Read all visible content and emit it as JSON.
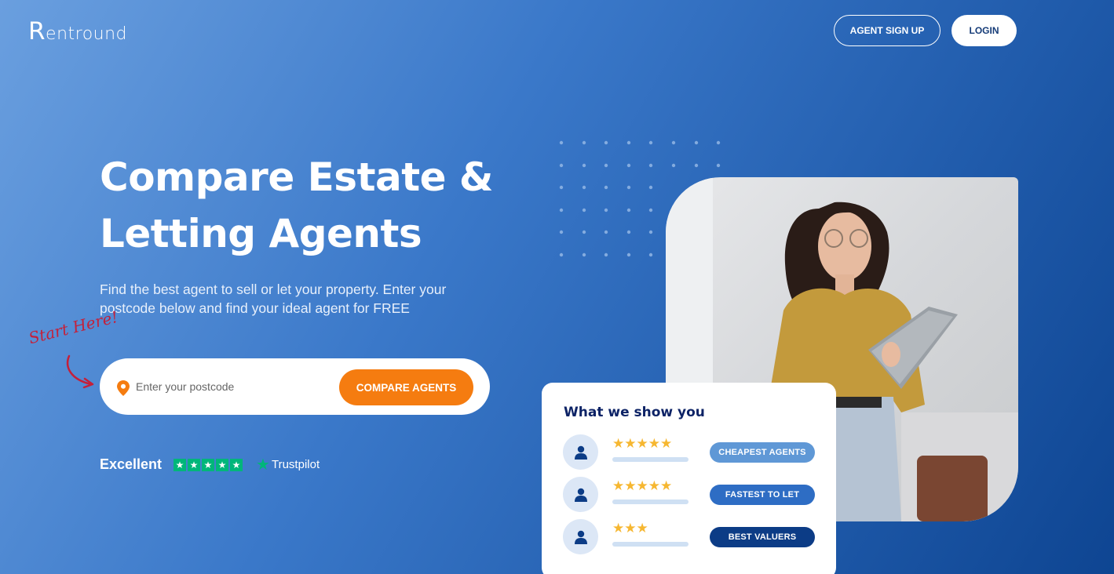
{
  "header": {
    "logo_first_letter": "R",
    "logo_rest": "entround",
    "agent_signup_label": "AGENT SIGN UP",
    "login_label": "LOGIN"
  },
  "hero": {
    "title_line1": "Compare Estate &",
    "title_line2": "Letting Agents",
    "subtitle": "Find the best agent to sell or let your property. Enter your postcode below and find your ideal agent for FREE",
    "start_here": "Start Here!"
  },
  "search": {
    "placeholder": "Enter your postcode",
    "value": "",
    "button_label": "COMPARE AGENTS"
  },
  "trust": {
    "rating_text": "Excellent",
    "stars": 5,
    "brand": "Trustpilot"
  },
  "card": {
    "title": "What we show you",
    "rows": [
      {
        "stars": 5,
        "star_glyphs": "★★★★★",
        "badge": "CHEAPEST AGENTS",
        "badge_color": "#5f98d6"
      },
      {
        "stars": 5,
        "star_glyphs": "★★★★★",
        "badge": "FASTEST TO LET",
        "badge_color": "#2e6dc4"
      },
      {
        "stars": 3,
        "star_glyphs": "★★★",
        "badge": "BEST VALUERS",
        "badge_color": "#0c3c86"
      }
    ]
  },
  "colors": {
    "accent_orange": "#f57c10",
    "trustpilot_green": "#00b67a",
    "star_yellow": "#f6b731",
    "navy": "#0d2366"
  }
}
